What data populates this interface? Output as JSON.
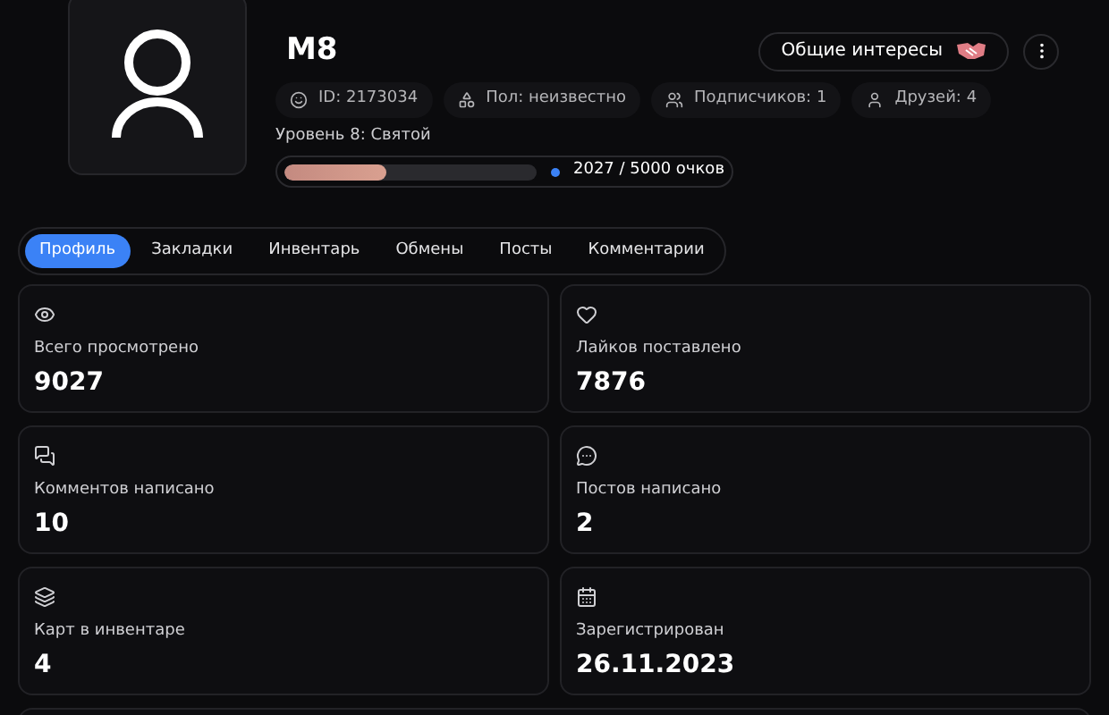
{
  "profile": {
    "name": "M8",
    "common_interests_button": "Общие интересы",
    "chips": [
      "ID: 2173034",
      "Пол: неизвестно",
      "Подписчиков: 1",
      "Друзей: 4"
    ],
    "level_label": "Уровень 8: Святой",
    "progress": {
      "level": 0.405,
      "reading": "2027 / 5000 очков"
    }
  },
  "tabs": [
    {
      "label": "Профиль",
      "selected": true
    },
    {
      "label": "Закладки",
      "selected": false
    },
    {
      "label": "Инвентарь",
      "selected": false
    },
    {
      "label": "Обмены",
      "selected": false
    },
    {
      "label": "Посты",
      "selected": false
    },
    {
      "label": "Комментарии",
      "selected": false
    }
  ],
  "stats": [
    {
      "label": "Всего просмотрено",
      "value": "9027"
    },
    {
      "label": "Лайков поставлено",
      "value": "7876"
    },
    {
      "label": "Комментов написано",
      "value": "10"
    },
    {
      "label": "Постов написано",
      "value": "2"
    },
    {
      "label": "Карт в инвентаре",
      "value": "4"
    },
    {
      "label": "Зарегистрирован",
      "value": "26.11.2023"
    }
  ]
}
